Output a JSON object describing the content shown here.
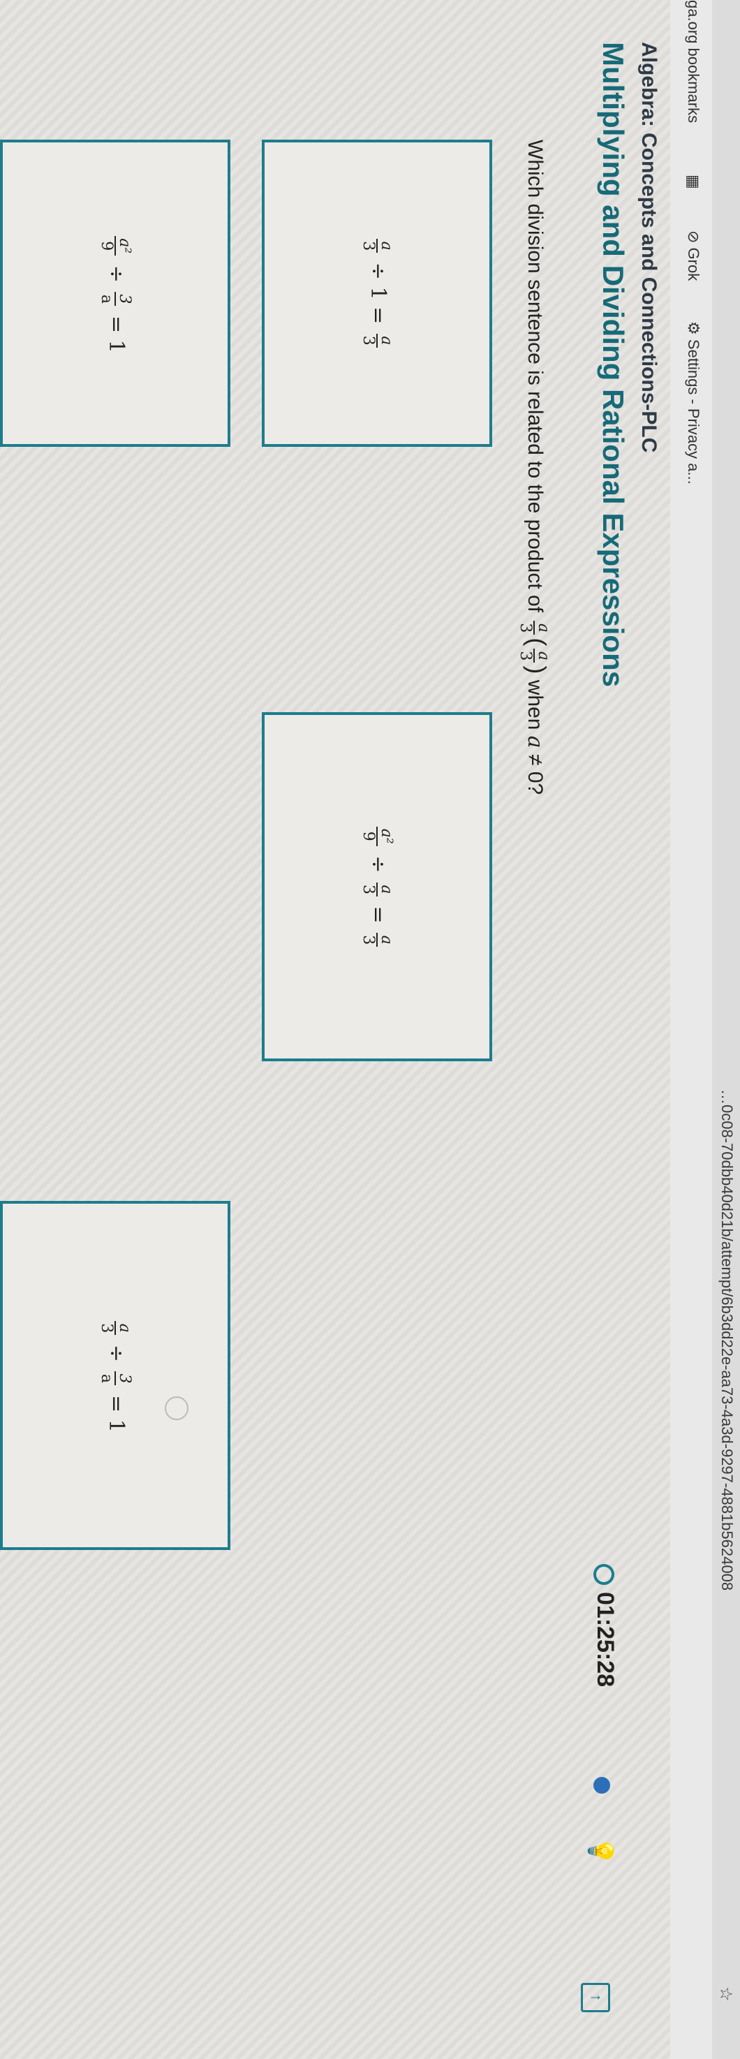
{
  "browser": {
    "url": "…0c08-70dbb40d21b/attempt/6b3dd22e-aa73-4a3d-9297-4881b5624008",
    "bookmarks": [
      "ga.org bookmarks",
      "Grok",
      "Settings - Privacy a..."
    ]
  },
  "header": {
    "course": "Algebra: Concepts and Connections-PLC",
    "lesson": "Multiplying and Dividing Rational Expressions",
    "timer": "01:25:28"
  },
  "question": {
    "prefix": "Which division sentence is related to the product of",
    "frac_num": "a",
    "frac_den": "3",
    "suffix": "when",
    "var": "a",
    "cond": "≠ 0?"
  },
  "options": [
    {
      "a": "a",
      "b": "3",
      "op": "÷",
      "c": "1",
      "eq": "=",
      "d": "a",
      "e": "3"
    },
    {
      "a": "a²",
      "b": "9",
      "op": "÷",
      "c": "3",
      "d": "a",
      "eq": "=",
      "r": "1"
    },
    {
      "a": "a²",
      "b": "9",
      "op": "÷",
      "c": "a",
      "d": "3",
      "eq": "=",
      "e": "a",
      "f": "3"
    },
    {
      "a": "a",
      "b": "3",
      "op": "÷",
      "c": "3",
      "d": "a",
      "eq": "=",
      "r": "1"
    }
  ],
  "colors": {
    "accent": "#1d7d8c",
    "title": "#176a78"
  }
}
